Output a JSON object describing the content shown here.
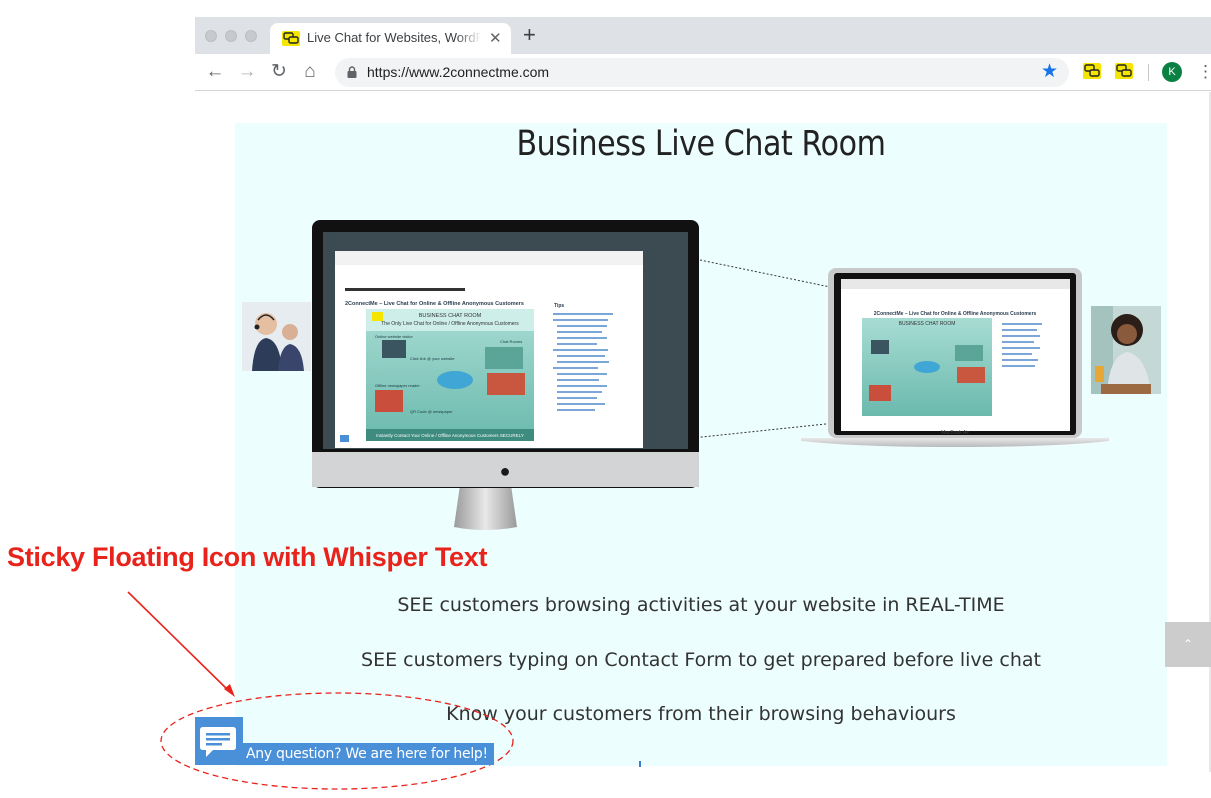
{
  "browser": {
    "tab_title": "Live Chat for Websites, WordPress",
    "tab_close": "✕",
    "new_tab": "+",
    "url": "https://www.2connectme.com",
    "nav": {
      "back": "←",
      "forward": "→",
      "reload": "↻",
      "home": "⌂"
    },
    "bookmark_star": "★",
    "profile_initial": "K",
    "menu": "⋮",
    "icons": [
      "back-icon",
      "forward-icon",
      "reload-icon",
      "home-icon",
      "lock-icon",
      "star-icon",
      "extension-icon",
      "menu-icon"
    ]
  },
  "page": {
    "hero_title": "Business Live Chat Room",
    "features": [
      "SEE customers browsing activities at your website in REAL-TIME",
      "SEE customers typing on Contact Form to get prepared before live chat",
      "Know your customers from their browsing behaviours"
    ],
    "scroll_top_glyph": "⌃"
  },
  "monitor_screen": {
    "site_title": "2ConnectMe – Live Chat for Online & Offline Anonymous Customers",
    "banner_heading": "BUSINESS CHAT ROOM",
    "banner_sub": "The Only Live Chat for Online / Offline Anonymous Customers",
    "labels": [
      "Online website visitor",
      "Chat Rooms",
      "Click link @ your website",
      "Offline newspaper reader",
      "QR Code @ newspaper"
    ],
    "banner_footer": "Instantly Contact Your Online / Offline Anonymous Customers SECURELY",
    "tips_heading": "Tips"
  },
  "laptop_screen": {
    "site_title": "2ConnectMe – Live Chat for Online & Offline Anonymous Customers",
    "banner_heading": "BUSINESS CHAT ROOM",
    "brand": "MacBook Air"
  },
  "annotation": {
    "label": "Sticky Floating Icon with Whisper Text"
  },
  "chat_widget": {
    "whisper_text": "Any question? We are here for help!"
  },
  "colors": {
    "accent": "#4a90d9",
    "annotation": "#e8231b",
    "panel": "#edfefe"
  }
}
